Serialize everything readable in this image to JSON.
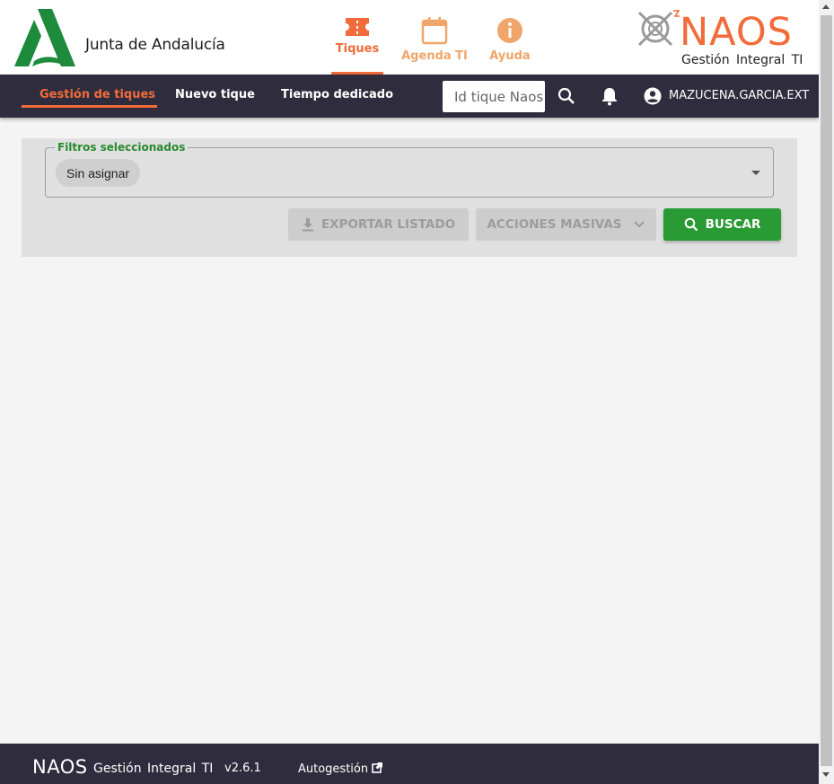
{
  "header": {
    "org_name": "Junta de Andalucía",
    "app_tabs": [
      {
        "label": "Tiques",
        "icon": "ticket-icon",
        "active": true
      },
      {
        "label": "Agenda TI",
        "icon": "calendar-icon",
        "active": false
      },
      {
        "label": "Ayuda",
        "icon": "info-icon",
        "active": false
      }
    ],
    "brand": {
      "name": "NAOS",
      "subtitle": "Gestión Integral TI"
    }
  },
  "nav": {
    "items": [
      {
        "label": "Gestión de tiques",
        "active": true
      },
      {
        "label": "Nuevo tique",
        "active": false
      },
      {
        "label": "Tiempo dedicado",
        "active": false
      }
    ],
    "search_placeholder": "Id tique Naos",
    "user": "MAZUCENA.GARCIA.EXT"
  },
  "filters": {
    "legend": "Filtros seleccionados",
    "chips": [
      "Sin asignar"
    ],
    "buttons": {
      "export": "EXPORTAR LISTADO",
      "acciones": "ACCIONES MASIVAS",
      "buscar": "BUSCAR"
    }
  },
  "footer": {
    "brand": "NAOS",
    "subtitle": "Gestión Integral TI",
    "version": "v2.6.1",
    "link": "Autogestión"
  },
  "colors": {
    "accent": "#f26b3a",
    "nav_bg": "#2f2d3d",
    "primary_green": "#2a9a34",
    "ja_green": "#1e8a3c"
  }
}
